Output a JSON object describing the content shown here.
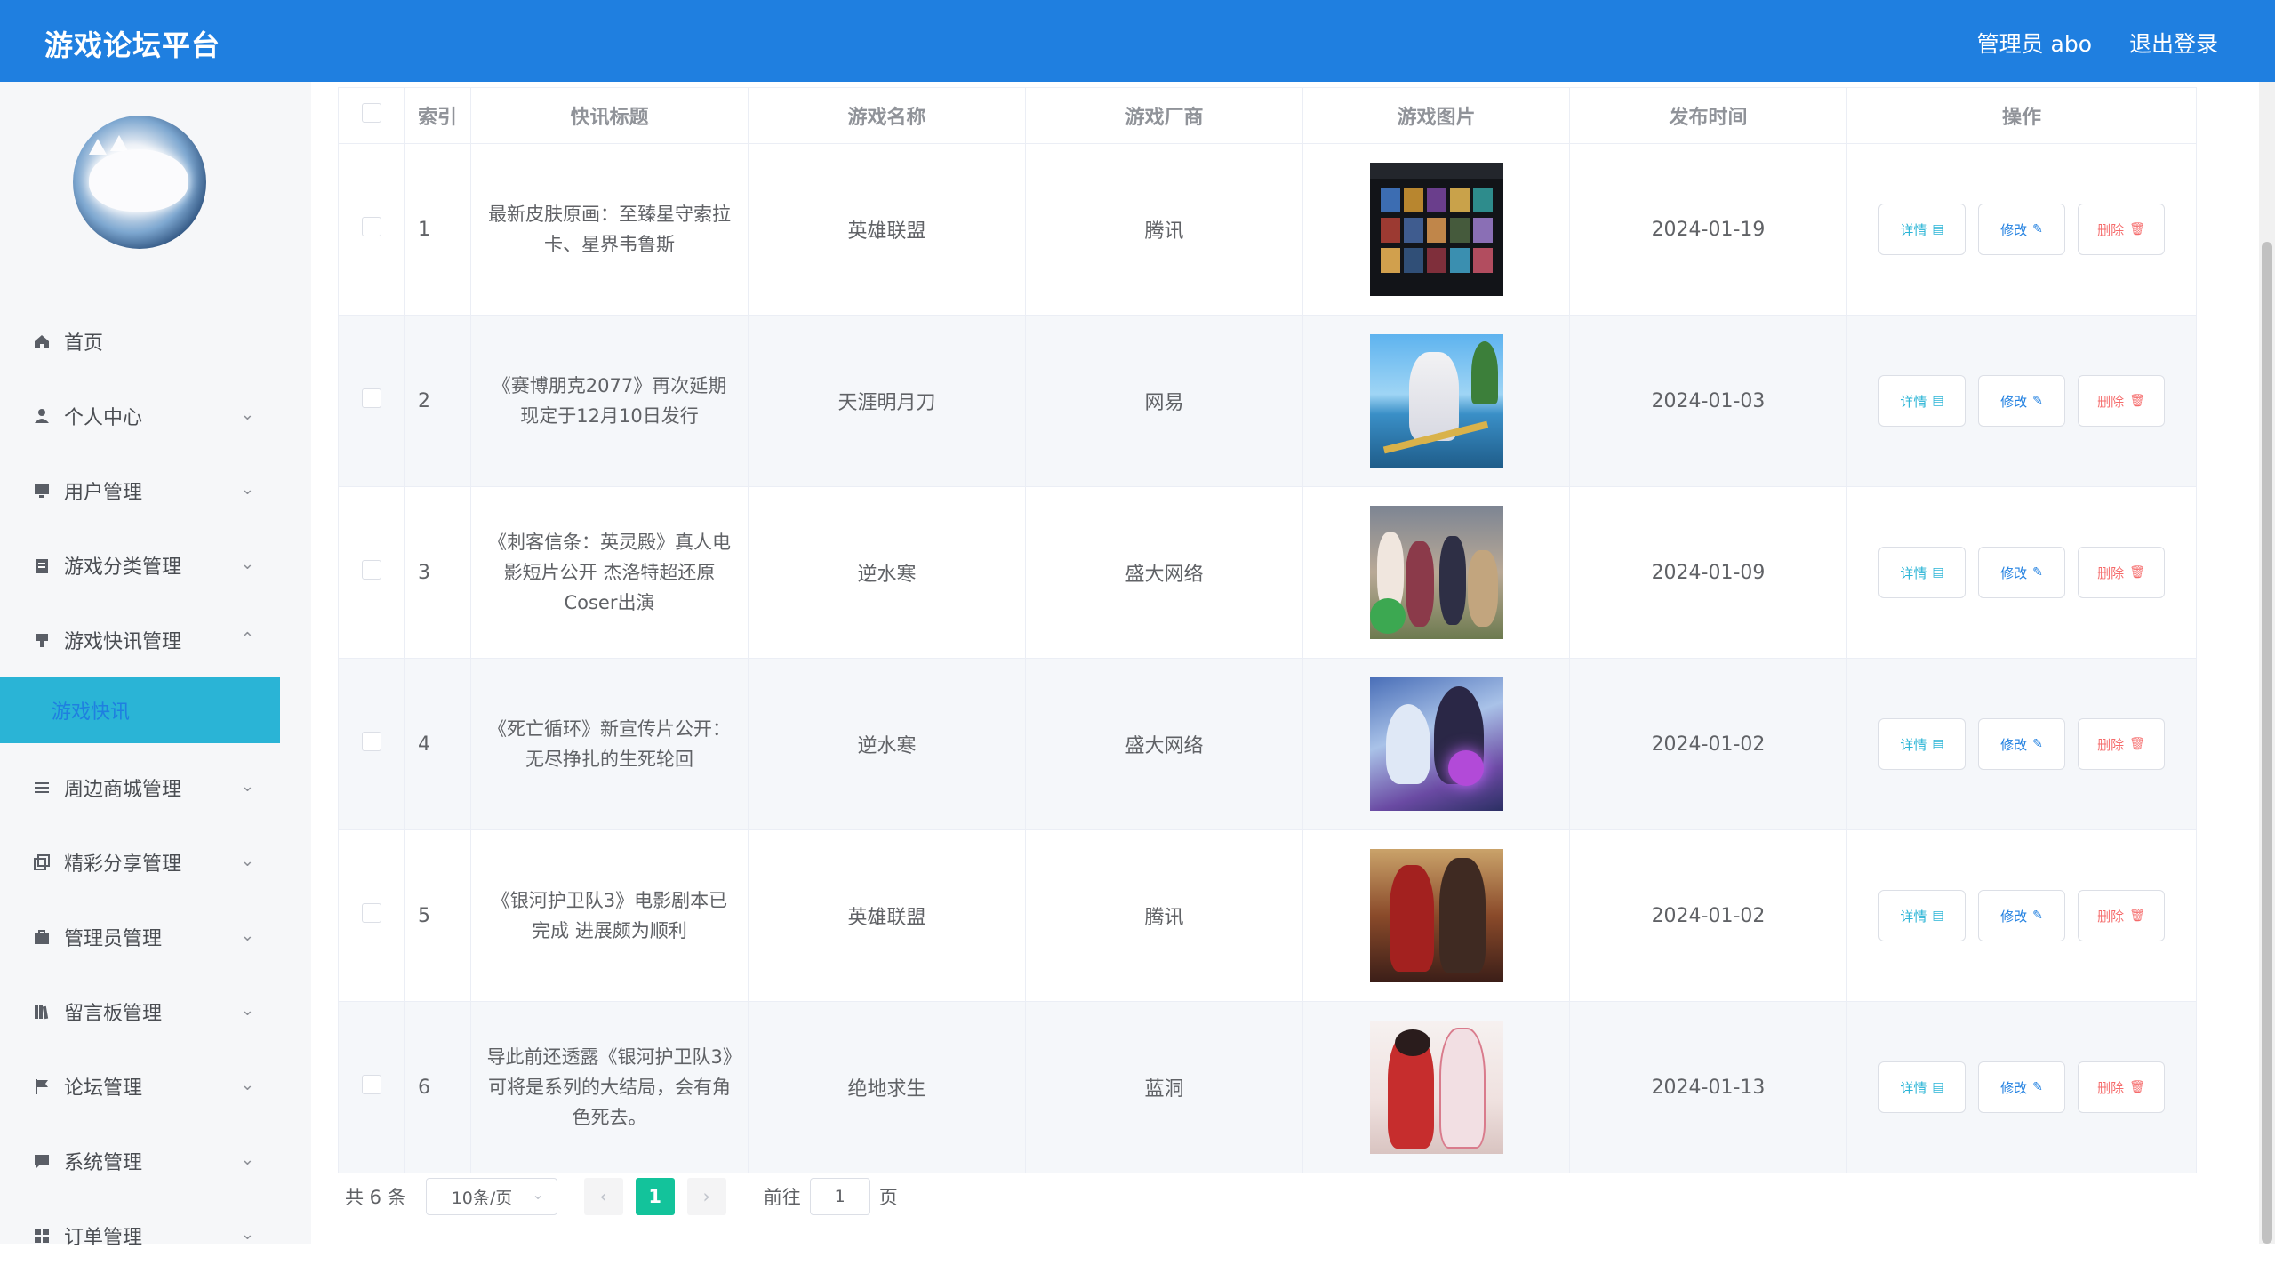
{
  "app": {
    "title": "游戏论坛平台"
  },
  "header": {
    "user_label": "管理员 abo",
    "logout_label": "退出登录"
  },
  "sidebar": {
    "items": [
      {
        "label": "首页",
        "icon": "home-icon",
        "expandable": false
      },
      {
        "label": "个人中心",
        "icon": "user-icon",
        "expandable": true
      },
      {
        "label": "用户管理",
        "icon": "monitor-icon",
        "expandable": true
      },
      {
        "label": "游戏分类管理",
        "icon": "clipboard-icon",
        "expandable": true
      },
      {
        "label": "游戏快讯管理",
        "icon": "news-icon",
        "expandable": true,
        "expanded": true
      },
      {
        "label": "周边商城管理",
        "icon": "list-icon",
        "expandable": true
      },
      {
        "label": "精彩分享管理",
        "icon": "copy-icon",
        "expandable": true
      },
      {
        "label": "管理员管理",
        "icon": "briefcase-icon",
        "expandable": true
      },
      {
        "label": "留言板管理",
        "icon": "books-icon",
        "expandable": true
      },
      {
        "label": "论坛管理",
        "icon": "flag-icon",
        "expandable": true
      },
      {
        "label": "系统管理",
        "icon": "chat-icon",
        "expandable": true
      },
      {
        "label": "订单管理",
        "icon": "grid-icon",
        "expandable": true
      }
    ],
    "active_sub_item": "游戏快讯"
  },
  "table": {
    "columns": [
      "索引",
      "快讯标题",
      "游戏名称",
      "游戏厂商",
      "游戏图片",
      "发布时间",
      "操作"
    ],
    "rows": [
      {
        "index": "1",
        "title": "最新皮肤原画：至臻星守索拉卡、星界韦鲁斯",
        "game": "英雄联盟",
        "vendor": "腾讯",
        "date": "2024-01-19"
      },
      {
        "index": "2",
        "title": "《赛博朋克2077》再次延期 现定于12月10日发行",
        "game": "天涯明月刀",
        "vendor": "网易",
        "date": "2024-01-03"
      },
      {
        "index": "3",
        "title": "《刺客信条：英灵殿》真人电影短片公开 杰洛特超还原Coser出演",
        "game": "逆水寒",
        "vendor": "盛大网络",
        "date": "2024-01-09"
      },
      {
        "index": "4",
        "title": "《死亡循环》新宣传片公开：无尽挣扎的生死轮回",
        "game": "逆水寒",
        "vendor": "盛大网络",
        "date": "2024-01-02"
      },
      {
        "index": "5",
        "title": "《银河护卫队3》电影剧本已完成 进展颇为顺利",
        "game": "英雄联盟",
        "vendor": "腾讯",
        "date": "2024-01-02"
      },
      {
        "index": "6",
        "title": "导此前还透露《银河护卫队3》可将是系列的大结局，会有角色死去。",
        "game": "绝地求生",
        "vendor": "蓝洞",
        "date": "2024-01-13"
      }
    ],
    "actions": {
      "detail": "详情",
      "edit": "修改",
      "delete": "删除"
    }
  },
  "pagination": {
    "total_label": "共 6 条",
    "page_size_label": "10条/页",
    "current_page": "1",
    "goto_prefix": "前往",
    "goto_value": "1",
    "goto_suffix": "页"
  },
  "colors": {
    "header": "#1f7fe0",
    "active_menu": "#2ab4d6",
    "current_page": "#13c39b",
    "delete": "#f56c6c"
  }
}
